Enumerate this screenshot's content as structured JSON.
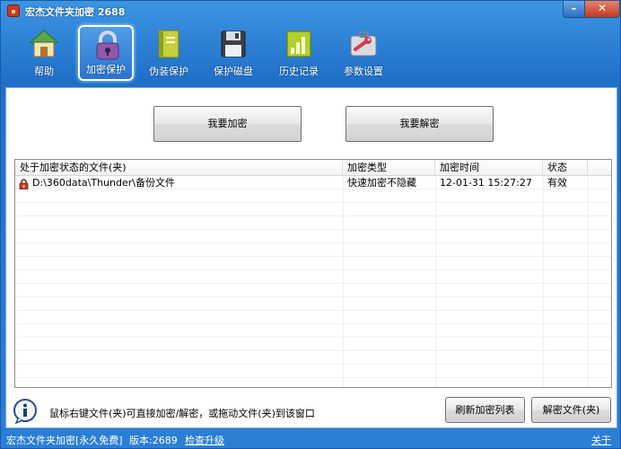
{
  "window": {
    "title": "宏杰文件夹加密  2688",
    "minimize_glyph": "–",
    "close_glyph": "✕"
  },
  "toolbar": {
    "items": [
      {
        "label": "帮助",
        "icon": "home-icon"
      },
      {
        "label": "加密保护",
        "icon": "lock-icon",
        "active": true
      },
      {
        "label": "伪装保护",
        "icon": "notebook-icon"
      },
      {
        "label": "保护磁盘",
        "icon": "floppy-disk-icon"
      },
      {
        "label": "历史记录",
        "icon": "history-chart-icon"
      },
      {
        "label": "参数设置",
        "icon": "wrench-icon"
      }
    ]
  },
  "actions": {
    "encrypt_label": "我要加密",
    "decrypt_label": "我要解密"
  },
  "file_list": {
    "columns": [
      "处于加密状态的文件(夹)",
      "加密类型",
      "加密时间",
      "状态"
    ],
    "rows": [
      {
        "path": "D:\\360data\\Thunder\\备份文件",
        "type": "快速加密不隐藏",
        "time": "12-01-31 15:27:27",
        "status": "有效"
      }
    ]
  },
  "hint": {
    "text": "鼠标右键文件(夹)可直接加密/解密，或拖动文件(夹)到该窗口"
  },
  "bottom_buttons": {
    "refresh_label": "刷新加密列表",
    "decrypt_file_label": "解密文件(夹)"
  },
  "statusbar": {
    "product": "宏杰文件夹加密[永久免费]",
    "version": "版本:2689",
    "check_update": "检查升级",
    "about": "关于"
  },
  "colors": {
    "window_blue": "#2b7fd6",
    "panel_bg": "#ffffff",
    "close_red": "#c03a24"
  }
}
